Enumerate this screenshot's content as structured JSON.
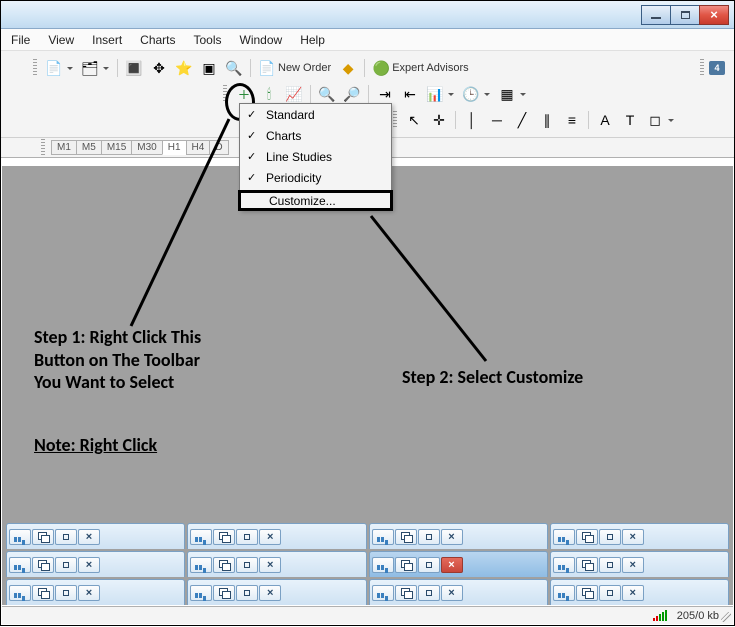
{
  "menu": {
    "items": [
      "File",
      "View",
      "Insert",
      "Charts",
      "Tools",
      "Window",
      "Help"
    ]
  },
  "toolbar1": {
    "new_order": "New Order",
    "expert_advisors": "Expert Advisors"
  },
  "periods": [
    "M1",
    "M5",
    "M15",
    "M30",
    "H1",
    "H4",
    "D"
  ],
  "period_active_index": 4,
  "context_menu": {
    "items": [
      {
        "label": "Standard",
        "checked": true
      },
      {
        "label": "Charts",
        "checked": true
      },
      {
        "label": "Line Studies",
        "checked": true
      },
      {
        "label": "Periodicity",
        "checked": true
      }
    ],
    "customize": "Customize..."
  },
  "annotations": {
    "step1_l1": "Step 1: Right Click This",
    "step1_l2": "Button on The Toolbar",
    "step1_l3": "You Want to Select",
    "step2": "Step 2: Select Customize",
    "note": "Note: Right Click"
  },
  "status": {
    "traffic": "205/0 kb"
  },
  "badge": "4"
}
